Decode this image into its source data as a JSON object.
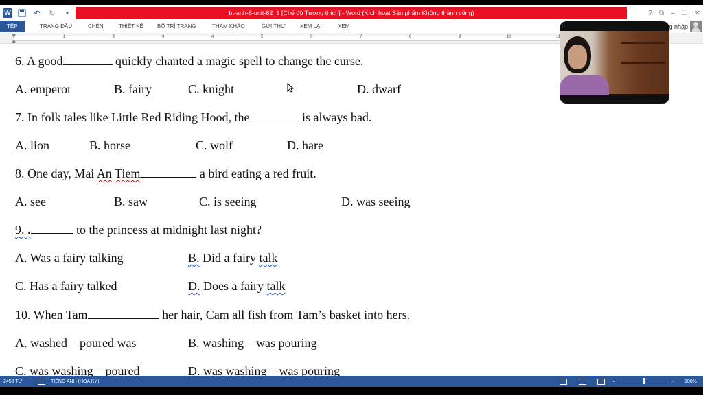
{
  "window": {
    "title": "bt-anh-8-unit-62_1 [Chế độ Tương thích] - Word (Kích hoạt Sản phẩm Không thành công)",
    "controls": [
      "?",
      "⧉",
      "–",
      "❐",
      "✕"
    ]
  },
  "ribbon": {
    "tabs": [
      "TỆP",
      "TRANG ĐẦU",
      "CHÈN",
      "THIẾT KẾ",
      "BỐ TRÍ TRANG",
      "THAM KHẢO",
      "GỬI THƯ",
      "XEM LẠI",
      "XEM"
    ],
    "active_tab": "TỆP",
    "signin": "g nhập"
  },
  "ruler": {
    "numbers": [
      "1",
      "2",
      "3",
      "4",
      "5",
      "6",
      "7",
      "8",
      "9",
      "10",
      "11"
    ]
  },
  "document": {
    "q6": {
      "text_before": "6. A good",
      "text_after": " quickly chanted a magic spell to change the curse."
    },
    "q6_options": [
      "A. emperor",
      "B. fairy",
      "C. knight",
      "D. dwarf"
    ],
    "q7": {
      "text_before": "7. In folk tales like Little Red Riding Hood, the",
      "text_after": " is always bad."
    },
    "q7_options": [
      "A. lion",
      "B. horse",
      "C. wolf",
      "D. hare"
    ],
    "q8": {
      "text_before": "8. One day, Mai ",
      "w1": "An",
      "w2": "Tiem",
      "text_after": " a bird eating a red fruit."
    },
    "q8_options": [
      "A. see",
      "B. saw",
      "C. is seeing",
      "D. was seeing"
    ],
    "q9": {
      "num": "9. .",
      "text_after": " to the princess at midnight last night?"
    },
    "q9_options": {
      "a": "A. Was a fairy talking",
      "b_prefix": "B.",
      "b_mid": " Did a fairy ",
      "b_word": "talk",
      "c": "C. Has a fairy talked",
      "d_prefix": "D.",
      "d_mid": " Does a fairy ",
      "d_word": "talk"
    },
    "q10": {
      "text_before": "10. When Tam",
      "text_after": " her hair, Cam all fish from Tam’s basket into hers."
    },
    "q10_options": [
      "A. washed – poured was",
      "B. washing – was pouring",
      "C. was washing – poured",
      "D. was washing – was pouring"
    ]
  },
  "statusbar": {
    "word_count": "2458 TỪ",
    "language": "TIẾNG ANH (HOA KỲ)",
    "zoom": "100%",
    "zoom_minus": "-",
    "zoom_plus": "+"
  }
}
